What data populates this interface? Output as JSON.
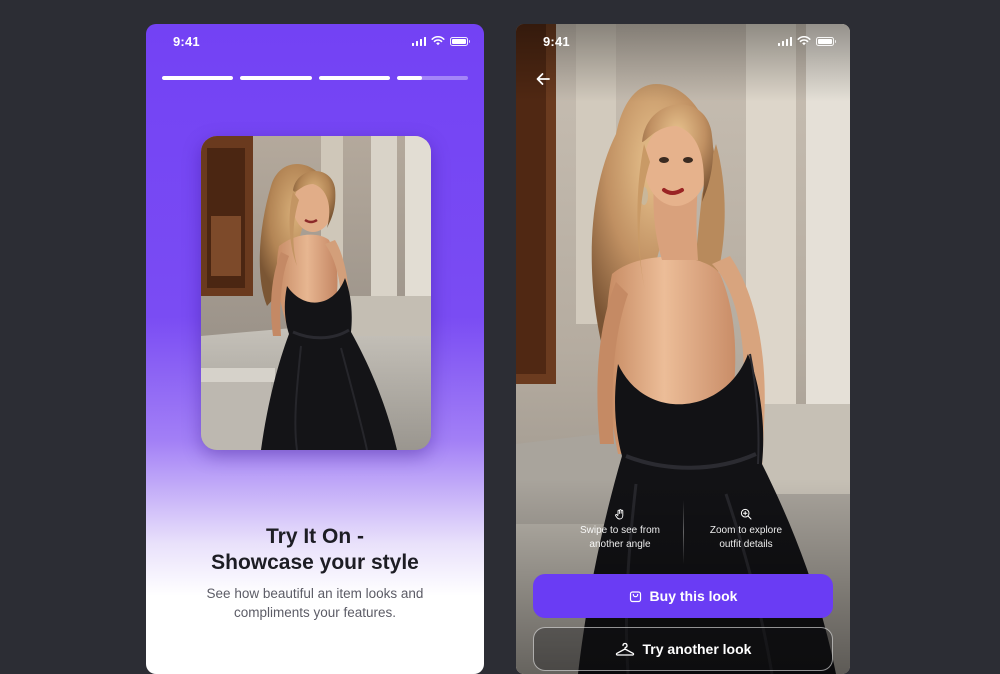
{
  "onboarding": {
    "status": {
      "time": "9:41"
    },
    "progress": [
      1,
      1,
      1,
      0.35
    ],
    "title_lines": [
      "Try It On -",
      "Showcase your style"
    ],
    "subtitle_lines": [
      "See how beautiful an item looks and",
      "compliments your features."
    ],
    "colors": {
      "accent": "#7342f4",
      "title": "#1d1d24",
      "subtitle": "#5c5c66"
    }
  },
  "tryon": {
    "status": {
      "time": "9:41"
    },
    "hints": [
      {
        "icon": "hand-swipe-icon",
        "lines": [
          "Swipe to see from",
          "another angle"
        ]
      },
      {
        "icon": "zoom-in-icon",
        "lines": [
          "Zoom to explore",
          "outfit details"
        ]
      }
    ],
    "primary_button": {
      "label": "Buy this look",
      "icon": "shopping-bag-icon"
    },
    "secondary_button": {
      "label": "Try another look",
      "icon": "hanger-icon"
    },
    "colors": {
      "button": "#6a3cf4",
      "dress": "#111114"
    }
  }
}
